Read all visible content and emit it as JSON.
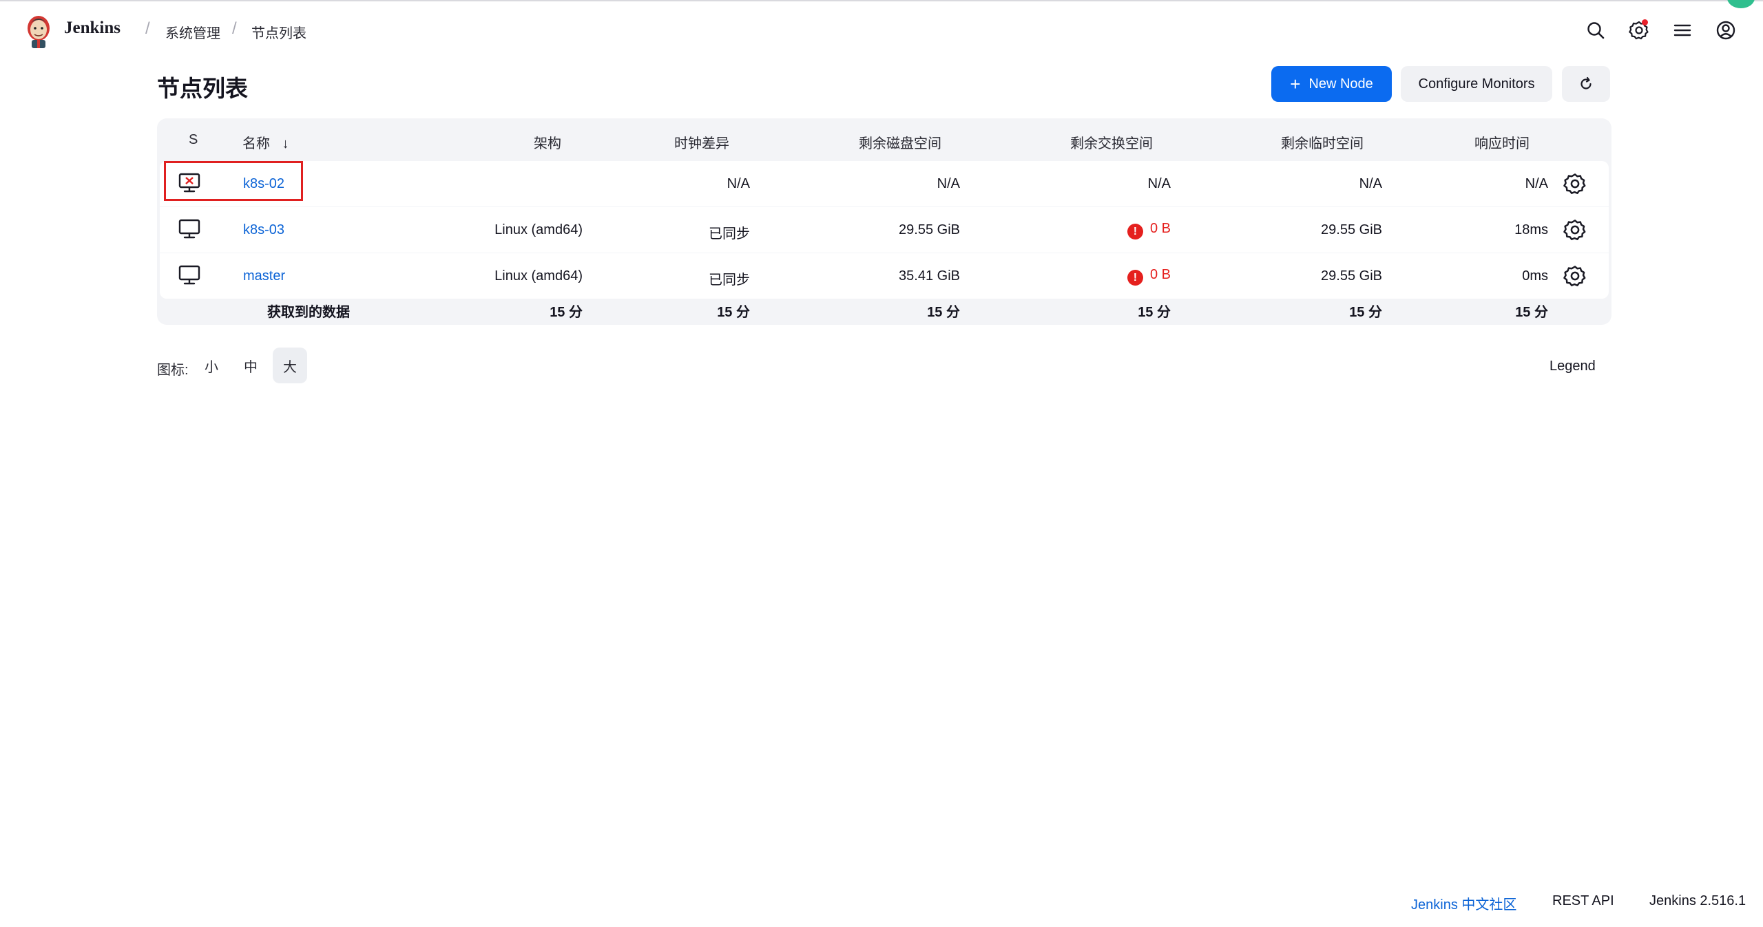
{
  "header": {
    "brand": "Jenkins",
    "breadcrumbs": [
      "系统管理",
      "节点列表"
    ],
    "icons": [
      "search-icon",
      "settings-gear-icon",
      "menu-icon",
      "account-icon"
    ]
  },
  "page": {
    "title": "节点列表",
    "new_node_label": "New Node",
    "configure_monitors_label": "Configure Monitors"
  },
  "table": {
    "columns": [
      "S",
      "名称",
      "架构",
      "时钟差异",
      "剩余磁盘空间",
      "剩余交换空间",
      "剩余临时空间",
      "响应时间"
    ],
    "sort_indicator": "↓",
    "rows": [
      {
        "status": "offline",
        "name": "k8s-02",
        "arch": "",
        "clock": "N/A",
        "disk": "N/A",
        "swap": "N/A",
        "temp": "N/A",
        "response": "N/A",
        "swap_warning": false
      },
      {
        "status": "online",
        "name": "k8s-03",
        "arch": "Linux (amd64)",
        "clock": "已同步",
        "disk": "29.55 GiB",
        "swap": "0 B",
        "temp": "29.55 GiB",
        "response": "18ms",
        "swap_warning": true
      },
      {
        "status": "online",
        "name": "master",
        "arch": "Linux (amd64)",
        "clock": "已同步",
        "disk": "35.41 GiB",
        "swap": "0 B",
        "temp": "29.55 GiB",
        "response": "0ms",
        "swap_warning": true
      }
    ],
    "footer": {
      "label": "获取到的数据",
      "arch": "15 分",
      "clock": "15 分",
      "disk": "15 分",
      "swap": "15 分",
      "temp": "15 分",
      "response": "15 分"
    },
    "warning_glyph": "!"
  },
  "icon_size": {
    "label": "图标:",
    "options": [
      "小",
      "中",
      "大"
    ],
    "selected": "大"
  },
  "legend_label": "Legend",
  "footer": {
    "community": "Jenkins 中文社区",
    "rest_api": "REST API",
    "version": "Jenkins 2.516.1"
  },
  "colors": {
    "primary": "#0b6bf0",
    "link": "#0b63d6",
    "warning": "#e5201e",
    "table_bg": "#f3f4f7"
  }
}
